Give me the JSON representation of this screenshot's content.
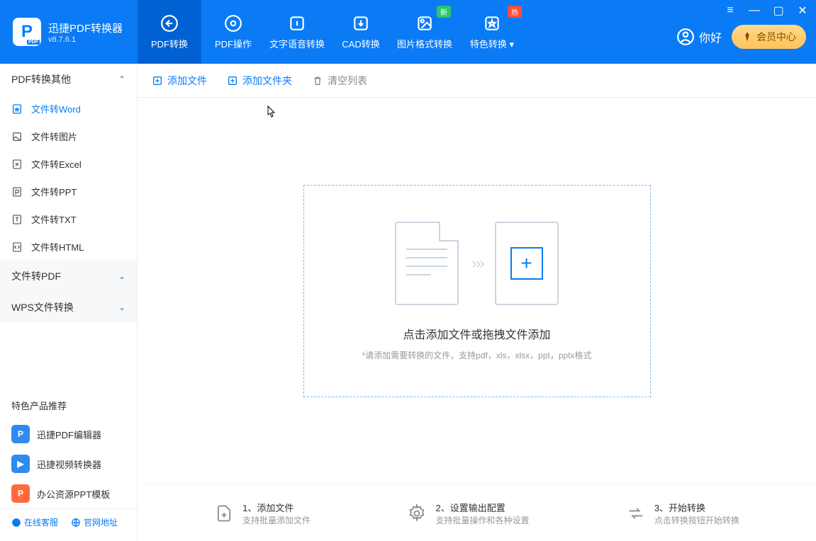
{
  "app": {
    "title": "迅捷PDF转换器",
    "version": "v8.7.6.1"
  },
  "nav": {
    "tabs": [
      {
        "label": "PDF转换",
        "badge": ""
      },
      {
        "label": "PDF操作",
        "badge": ""
      },
      {
        "label": "文字语音转换",
        "badge": ""
      },
      {
        "label": "CAD转换",
        "badge": ""
      },
      {
        "label": "图片格式转换",
        "badge": "新"
      },
      {
        "label": "特色转换",
        "badge": "热"
      }
    ]
  },
  "user": {
    "greeting": "你好",
    "member_btn": "会员中心"
  },
  "sidebar": {
    "groups": [
      {
        "label": "PDF转换其他"
      },
      {
        "label": "文件转PDF"
      },
      {
        "label": "WPS文件转换"
      }
    ],
    "items": [
      {
        "label": "文件转Word"
      },
      {
        "label": "文件转图片"
      },
      {
        "label": "文件转Excel"
      },
      {
        "label": "文件转PPT"
      },
      {
        "label": "文件转TXT"
      },
      {
        "label": "文件转HTML"
      }
    ],
    "featured_title": "特色产品推荐",
    "featured": [
      {
        "label": "迅捷PDF编辑器",
        "color": "#2e8bf0"
      },
      {
        "label": "迅捷视频转换器",
        "color": "#2e8bf0"
      },
      {
        "label": "办公资源PPT模板",
        "color": "#ff6a3d"
      }
    ],
    "footer": {
      "support": "在线客服",
      "site": "官网地址"
    }
  },
  "toolbar": {
    "add_file": "添加文件",
    "add_folder": "添加文件夹",
    "clear": "清空列表"
  },
  "dropzone": {
    "title": "点击添加文件或拖拽文件添加",
    "subtitle": "*请添加需要转换的文件，支持pdf，xls，xlsx，ppt，pptx格式"
  },
  "steps": [
    {
      "title": "1、添加文件",
      "sub": "支持批量添加文件"
    },
    {
      "title": "2、设置输出配置",
      "sub": "支持批量操作和各种设置"
    },
    {
      "title": "3、开始转换",
      "sub": "点击转换按钮开始转换"
    }
  ]
}
